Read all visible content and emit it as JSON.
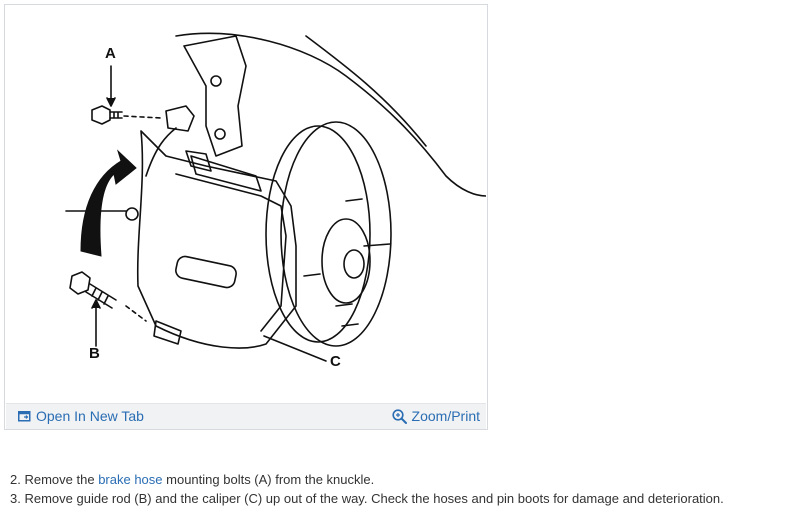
{
  "figure": {
    "callouts": {
      "a": "A",
      "b": "B",
      "c": "C"
    },
    "toolbar": {
      "open_new_tab": {
        "label": "Open In New Tab",
        "icon": "open-new-tab-icon"
      },
      "zoom_print": {
        "label": "Zoom/Print",
        "icon": "magnifier-icon"
      }
    }
  },
  "instructions": [
    {
      "number": "2.",
      "before": "Remove the",
      "link": "brake hose",
      "after": "mounting bolts (A) from the knuckle."
    },
    {
      "number": "3.",
      "text": "Remove guide rod (B) and the caliper (C) up out of the way. Check the hoses and pin boots for damage and deterioration."
    }
  ],
  "colors": {
    "link": "#2a6db3",
    "toolbar_bg": "#f1f2f4",
    "border": "#d6dadf",
    "text": "#333333"
  }
}
